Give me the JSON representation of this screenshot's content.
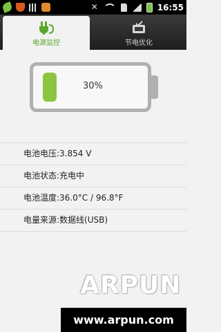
{
  "status_bar": {
    "left_icons": [
      "leaf-icon",
      "shield-icon",
      "signal-bars-icon",
      "gear-icon"
    ],
    "right_icons": [
      "mute-icon",
      "wifi-icon",
      "sd-card-icon",
      "cell-signal-icon",
      "battery-icon"
    ],
    "time": "16:55"
  },
  "tabs": [
    {
      "label": "电源监控",
      "icon": "power-plug-icon",
      "active": true
    },
    {
      "label": "节电优化",
      "icon": "tv-check-icon",
      "active": false
    }
  ],
  "battery": {
    "percent_text": "30%",
    "level": 0.3,
    "fill_color": "#8cc53f"
  },
  "info": {
    "voltage": "电池电压:3.854 V",
    "status": "电池状态:充电中",
    "temperature": "电池温度:36.0°C / 96.8°F",
    "source": "电量来源:数据线(USB)"
  },
  "watermark": {
    "title": "ARPUN",
    "url": "www.arpun.com"
  },
  "colors": {
    "accent": "#5aa72b",
    "tabbar": "#2a2a2a"
  }
}
